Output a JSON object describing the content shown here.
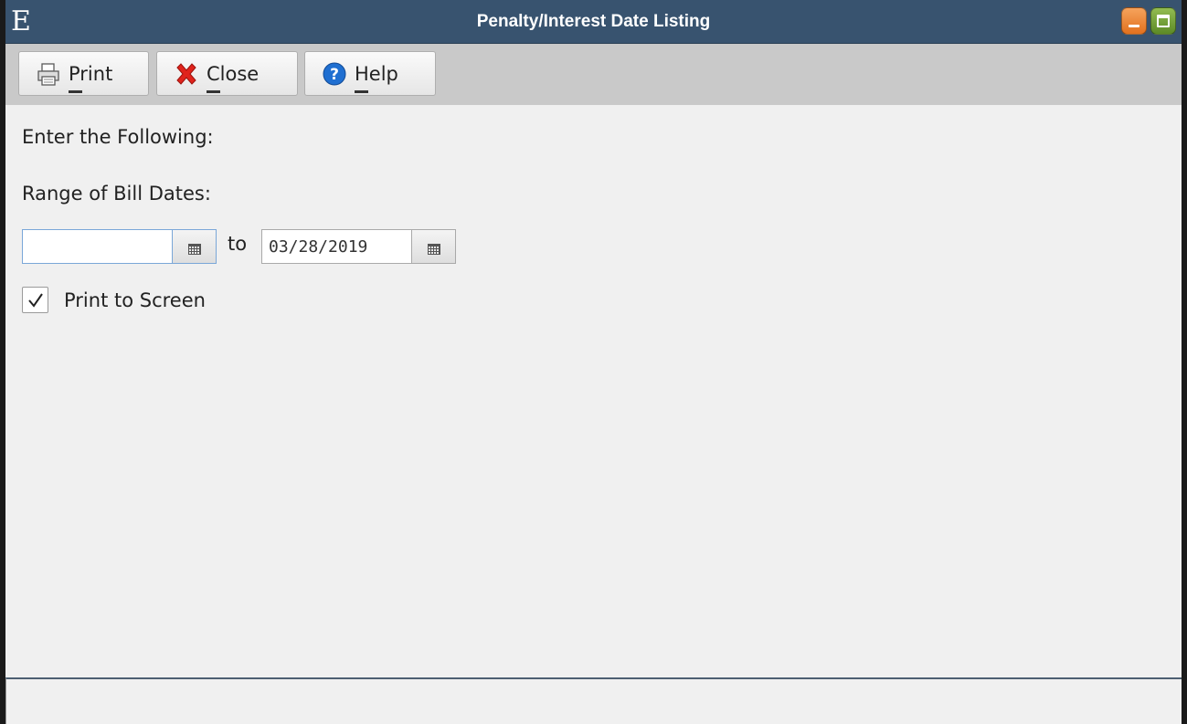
{
  "window": {
    "logo": "E",
    "title": "Penalty/Interest Date Listing",
    "colors": {
      "titlebar": "#38536f",
      "minimize": "#e2711e",
      "maximize": "#5c8a26"
    }
  },
  "toolbar": {
    "print_label": "Print",
    "close_label": "Close",
    "help_label": "Help",
    "icons": [
      "printer-icon",
      "red-x-icon",
      "help-question-icon"
    ]
  },
  "form": {
    "instruction": "Enter the Following:",
    "range_label": "Range of Bill Dates:",
    "from_date": "",
    "to_word": "to",
    "to_date": "03/28/2019",
    "print_to_screen_label": "Print to Screen",
    "print_to_screen_checked": true
  }
}
